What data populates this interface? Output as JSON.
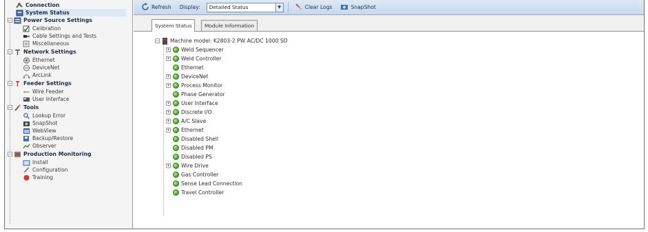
{
  "toolbar": {
    "refresh_label": "Refresh",
    "display_label": "Display:",
    "display_value": "Detailed Status",
    "clear_logs_label": "Clear Logs",
    "snapshot_label": "SnapShot"
  },
  "tabs": [
    {
      "label": "System Status",
      "active": true
    },
    {
      "label": "Module Information",
      "active": false
    }
  ],
  "nav": {
    "items": [
      {
        "label": "Connection",
        "kind": "category",
        "icon": "connection-icon"
      },
      {
        "label": "System Status",
        "kind": "category",
        "icon": "status-icon"
      },
      {
        "label": "Power Source Settings",
        "kind": "category",
        "icon": "power-source-icon"
      },
      {
        "label": "Calibration",
        "kind": "item",
        "icon": "calibration-icon"
      },
      {
        "label": "Cable Settings and Tests",
        "kind": "item",
        "icon": "cable-icon"
      },
      {
        "label": "Miscellaneous",
        "kind": "item",
        "icon": "misc-icon"
      },
      {
        "label": "Network Settings",
        "kind": "category",
        "icon": "network-icon"
      },
      {
        "label": "Ethernet",
        "kind": "item",
        "icon": "ethernet-icon"
      },
      {
        "label": "DeviceNet",
        "kind": "item",
        "icon": "devicenet-icon"
      },
      {
        "label": "ArcLink",
        "kind": "item",
        "icon": "arclink-icon"
      },
      {
        "label": "Feeder Settings",
        "kind": "category",
        "icon": "feeder-icon"
      },
      {
        "label": "Wire Feeder",
        "kind": "item",
        "icon": "wire-feeder-icon"
      },
      {
        "label": "User Interface",
        "kind": "item",
        "icon": "user-interface-icon"
      },
      {
        "label": "Tools",
        "kind": "category",
        "icon": "tools-icon"
      },
      {
        "label": "Lookup Error",
        "kind": "item",
        "icon": "lookup-icon"
      },
      {
        "label": "SnapShot",
        "kind": "item",
        "icon": "snapshot-icon"
      },
      {
        "label": "WebView",
        "kind": "item",
        "icon": "webview-icon"
      },
      {
        "label": "Backup/Restore",
        "kind": "item",
        "icon": "backup-icon"
      },
      {
        "label": "Observer",
        "kind": "item",
        "icon": "observer-icon"
      },
      {
        "label": "Production Monitoring",
        "kind": "category",
        "icon": "production-icon"
      },
      {
        "label": "Install",
        "kind": "item",
        "icon": "install-icon"
      },
      {
        "label": "Configuration",
        "kind": "item",
        "icon": "configuration-icon"
      },
      {
        "label": "Training",
        "kind": "item",
        "icon": "training-icon"
      }
    ]
  },
  "tree": {
    "root_label": "Machine model: K2803-2 PW AC/DC 1000 SD",
    "nodes": [
      {
        "label": "Weld Sequencer",
        "expandable": true
      },
      {
        "label": "Weld Controller",
        "expandable": true
      },
      {
        "label": "Ethernet",
        "expandable": false
      },
      {
        "label": "DeviceNet",
        "expandable": true
      },
      {
        "label": "Process Monitor",
        "expandable": true
      },
      {
        "label": "Phase Generator",
        "expandable": false
      },
      {
        "label": "User Interface",
        "expandable": true
      },
      {
        "label": "Discrete I/O",
        "expandable": true
      },
      {
        "label": "A/C Slave",
        "expandable": true
      },
      {
        "label": "Ethernet",
        "expandable": true
      },
      {
        "label": "Disabled Shell",
        "expandable": false
      },
      {
        "label": "Disabled PM",
        "expandable": false
      },
      {
        "label": "Disabled PS",
        "expandable": false
      },
      {
        "label": "Wire Drive",
        "expandable": true
      },
      {
        "label": "Gas Controller",
        "expandable": false
      },
      {
        "label": "Sense Lead Connection",
        "expandable": false
      },
      {
        "label": "Travel Controller",
        "expandable": false
      }
    ]
  },
  "colors": {
    "status_ok": "#3ba41c",
    "toolbar": "#c7d8ee",
    "category_text": "#1d2d4a"
  }
}
